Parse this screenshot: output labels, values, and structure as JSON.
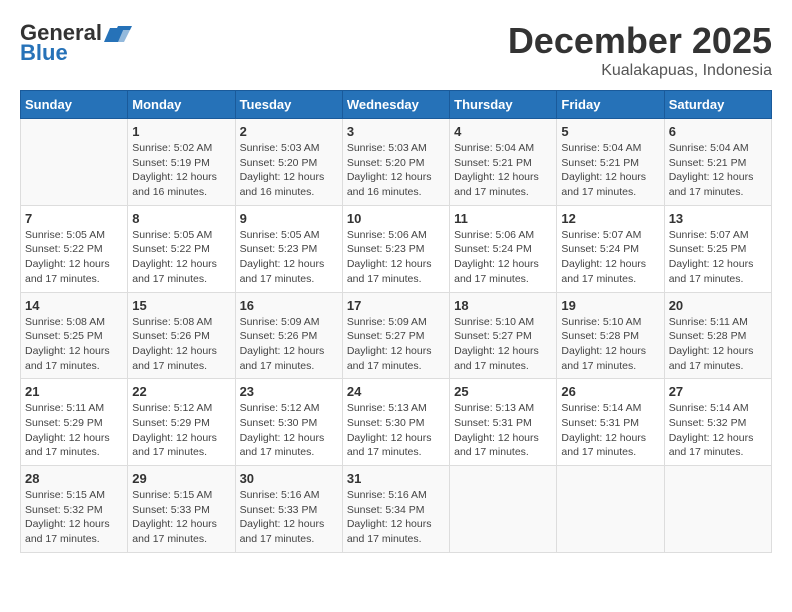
{
  "header": {
    "logo_line1": "General",
    "logo_line2": "Blue",
    "month_year": "December 2025",
    "location": "Kualakapuas, Indonesia"
  },
  "days_of_week": [
    "Sunday",
    "Monday",
    "Tuesday",
    "Wednesday",
    "Thursday",
    "Friday",
    "Saturday"
  ],
  "weeks": [
    [
      {
        "day": "",
        "info": ""
      },
      {
        "day": "1",
        "info": "Sunrise: 5:02 AM\nSunset: 5:19 PM\nDaylight: 12 hours\nand 16 minutes."
      },
      {
        "day": "2",
        "info": "Sunrise: 5:03 AM\nSunset: 5:20 PM\nDaylight: 12 hours\nand 16 minutes."
      },
      {
        "day": "3",
        "info": "Sunrise: 5:03 AM\nSunset: 5:20 PM\nDaylight: 12 hours\nand 16 minutes."
      },
      {
        "day": "4",
        "info": "Sunrise: 5:04 AM\nSunset: 5:21 PM\nDaylight: 12 hours\nand 17 minutes."
      },
      {
        "day": "5",
        "info": "Sunrise: 5:04 AM\nSunset: 5:21 PM\nDaylight: 12 hours\nand 17 minutes."
      },
      {
        "day": "6",
        "info": "Sunrise: 5:04 AM\nSunset: 5:21 PM\nDaylight: 12 hours\nand 17 minutes."
      }
    ],
    [
      {
        "day": "7",
        "info": "Sunrise: 5:05 AM\nSunset: 5:22 PM\nDaylight: 12 hours\nand 17 minutes."
      },
      {
        "day": "8",
        "info": "Sunrise: 5:05 AM\nSunset: 5:22 PM\nDaylight: 12 hours\nand 17 minutes."
      },
      {
        "day": "9",
        "info": "Sunrise: 5:05 AM\nSunset: 5:23 PM\nDaylight: 12 hours\nand 17 minutes."
      },
      {
        "day": "10",
        "info": "Sunrise: 5:06 AM\nSunset: 5:23 PM\nDaylight: 12 hours\nand 17 minutes."
      },
      {
        "day": "11",
        "info": "Sunrise: 5:06 AM\nSunset: 5:24 PM\nDaylight: 12 hours\nand 17 minutes."
      },
      {
        "day": "12",
        "info": "Sunrise: 5:07 AM\nSunset: 5:24 PM\nDaylight: 12 hours\nand 17 minutes."
      },
      {
        "day": "13",
        "info": "Sunrise: 5:07 AM\nSunset: 5:25 PM\nDaylight: 12 hours\nand 17 minutes."
      }
    ],
    [
      {
        "day": "14",
        "info": "Sunrise: 5:08 AM\nSunset: 5:25 PM\nDaylight: 12 hours\nand 17 minutes."
      },
      {
        "day": "15",
        "info": "Sunrise: 5:08 AM\nSunset: 5:26 PM\nDaylight: 12 hours\nand 17 minutes."
      },
      {
        "day": "16",
        "info": "Sunrise: 5:09 AM\nSunset: 5:26 PM\nDaylight: 12 hours\nand 17 minutes."
      },
      {
        "day": "17",
        "info": "Sunrise: 5:09 AM\nSunset: 5:27 PM\nDaylight: 12 hours\nand 17 minutes."
      },
      {
        "day": "18",
        "info": "Sunrise: 5:10 AM\nSunset: 5:27 PM\nDaylight: 12 hours\nand 17 minutes."
      },
      {
        "day": "19",
        "info": "Sunrise: 5:10 AM\nSunset: 5:28 PM\nDaylight: 12 hours\nand 17 minutes."
      },
      {
        "day": "20",
        "info": "Sunrise: 5:11 AM\nSunset: 5:28 PM\nDaylight: 12 hours\nand 17 minutes."
      }
    ],
    [
      {
        "day": "21",
        "info": "Sunrise: 5:11 AM\nSunset: 5:29 PM\nDaylight: 12 hours\nand 17 minutes."
      },
      {
        "day": "22",
        "info": "Sunrise: 5:12 AM\nSunset: 5:29 PM\nDaylight: 12 hours\nand 17 minutes."
      },
      {
        "day": "23",
        "info": "Sunrise: 5:12 AM\nSunset: 5:30 PM\nDaylight: 12 hours\nand 17 minutes."
      },
      {
        "day": "24",
        "info": "Sunrise: 5:13 AM\nSunset: 5:30 PM\nDaylight: 12 hours\nand 17 minutes."
      },
      {
        "day": "25",
        "info": "Sunrise: 5:13 AM\nSunset: 5:31 PM\nDaylight: 12 hours\nand 17 minutes."
      },
      {
        "day": "26",
        "info": "Sunrise: 5:14 AM\nSunset: 5:31 PM\nDaylight: 12 hours\nand 17 minutes."
      },
      {
        "day": "27",
        "info": "Sunrise: 5:14 AM\nSunset: 5:32 PM\nDaylight: 12 hours\nand 17 minutes."
      }
    ],
    [
      {
        "day": "28",
        "info": "Sunrise: 5:15 AM\nSunset: 5:32 PM\nDaylight: 12 hours\nand 17 minutes."
      },
      {
        "day": "29",
        "info": "Sunrise: 5:15 AM\nSunset: 5:33 PM\nDaylight: 12 hours\nand 17 minutes."
      },
      {
        "day": "30",
        "info": "Sunrise: 5:16 AM\nSunset: 5:33 PM\nDaylight: 12 hours\nand 17 minutes."
      },
      {
        "day": "31",
        "info": "Sunrise: 5:16 AM\nSunset: 5:34 PM\nDaylight: 12 hours\nand 17 minutes."
      },
      {
        "day": "",
        "info": ""
      },
      {
        "day": "",
        "info": ""
      },
      {
        "day": "",
        "info": ""
      }
    ]
  ]
}
